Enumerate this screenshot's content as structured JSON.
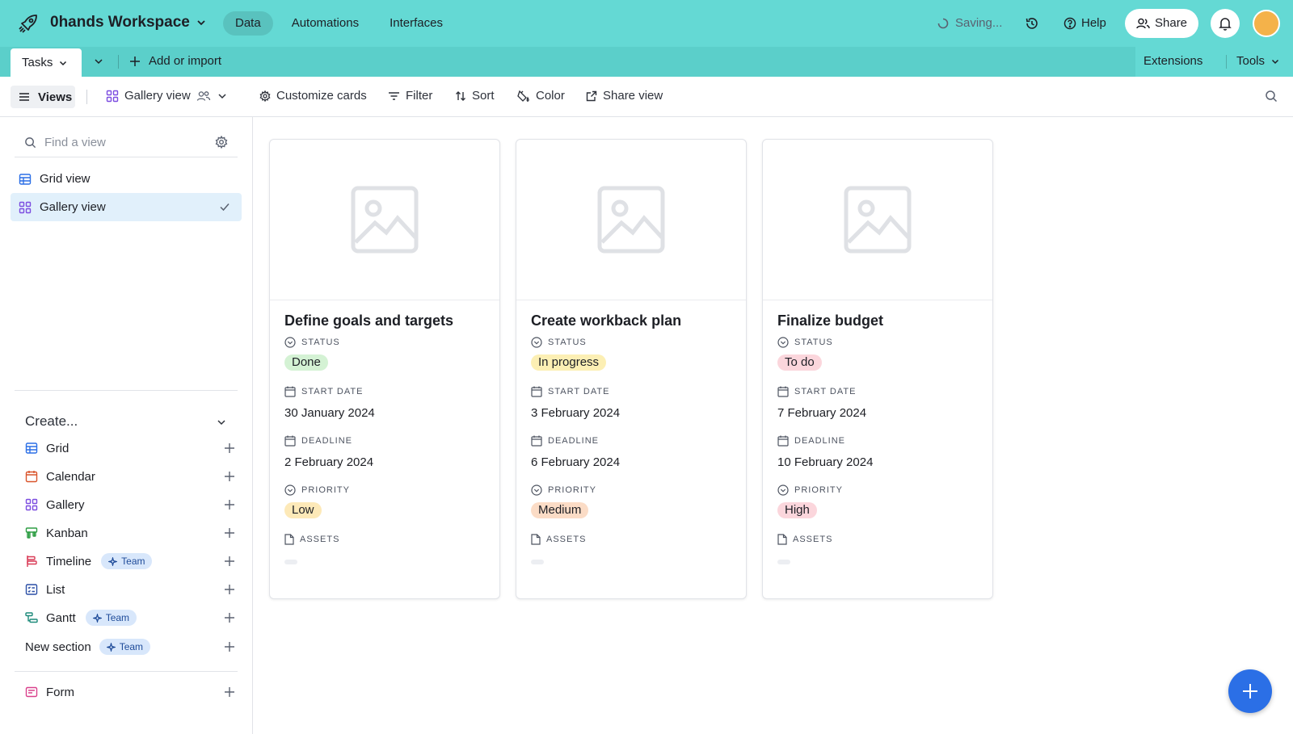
{
  "topbar": {
    "workspace_name": "0hands Workspace",
    "nav": [
      "Data",
      "Automations",
      "Interfaces"
    ],
    "active_nav": "Data",
    "saving": "Saving...",
    "help": "Help",
    "share": "Share",
    "avatar_color": "#f4b24a",
    "bg_color": "#64d9d4"
  },
  "tabbar": {
    "table_name": "Tasks",
    "add_import": "Add or import",
    "extensions": "Extensions",
    "tools": "Tools"
  },
  "viewbar": {
    "views": "Views",
    "current_view": "Gallery view",
    "customize": "Customize cards",
    "filter": "Filter",
    "sort": "Sort",
    "color": "Color",
    "share_view": "Share view"
  },
  "sidebar": {
    "search_placeholder": "Find a view",
    "views": [
      {
        "label": "Grid view",
        "icon": "grid-icon",
        "active": false
      },
      {
        "label": "Gallery view",
        "icon": "gallery-icon",
        "active": true
      }
    ],
    "create_label": "Create...",
    "create_items": [
      {
        "label": "Grid",
        "icon": "grid-icon",
        "team": false
      },
      {
        "label": "Calendar",
        "icon": "calendar-icon",
        "team": false
      },
      {
        "label": "Gallery",
        "icon": "gallery-icon",
        "team": false
      },
      {
        "label": "Kanban",
        "icon": "kanban-icon",
        "team": false
      },
      {
        "label": "Timeline",
        "icon": "timeline-icon",
        "team": true
      },
      {
        "label": "List",
        "icon": "list-icon",
        "team": false
      },
      {
        "label": "Gantt",
        "icon": "gantt-icon",
        "team": true
      },
      {
        "label": "New section",
        "icon": "",
        "team": true
      },
      {
        "label": "Form",
        "icon": "form-icon",
        "team": false
      }
    ],
    "team_badge": "Team"
  },
  "field_labels": {
    "status": "STATUS",
    "start_date": "START DATE",
    "deadline": "DEADLINE",
    "priority": "PRIORITY",
    "assets": "ASSETS"
  },
  "cards": [
    {
      "title": "Define goals and targets",
      "status": "Done",
      "start_date": "30 January 2024",
      "deadline": "2 February 2024",
      "priority": "Low",
      "status_color": "#d4f2d4",
      "priority_color": "#fde9b8"
    },
    {
      "title": "Create workback plan",
      "status": "In progress",
      "start_date": "3 February 2024",
      "deadline": "6 February 2024",
      "priority": "Medium",
      "status_color": "#fcefb4",
      "priority_color": "#fbdcc6"
    },
    {
      "title": "Finalize budget",
      "status": "To do",
      "start_date": "7 February 2024",
      "deadline": "10 February 2024",
      "priority": "High",
      "status_color": "#fbd6dc",
      "priority_color": "#fbd6dc"
    }
  ]
}
